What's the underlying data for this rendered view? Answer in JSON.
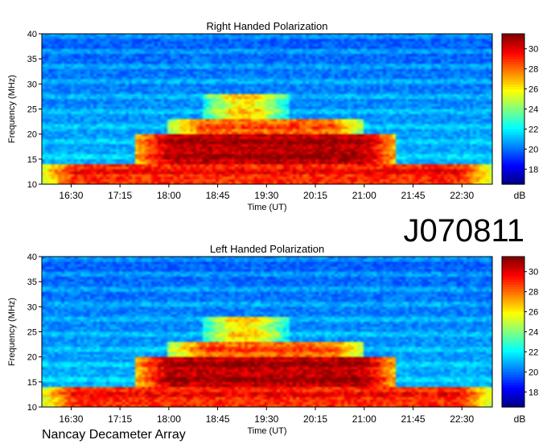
{
  "observation_id": "J070811",
  "footer": "Nancay Decameter Array",
  "colorbar": {
    "ticks": [
      18,
      20,
      22,
      24,
      26,
      28,
      30
    ],
    "range": [
      16.5,
      31.5
    ],
    "unit_label": "dB"
  },
  "colors": {
    "low": "#00008f",
    "mid_low": "#0060ff",
    "mid": "#00e5e5",
    "mid_high": "#ffe000",
    "high": "#ff3000",
    "max": "#8f0000"
  },
  "chart_data": [
    {
      "type": "heatmap",
      "title": "Right Handed Polarization",
      "xlabel": "Time (UT)",
      "ylabel": "Frequency (MHz)",
      "x_ticks": [
        "16:30",
        "17:15",
        "18:00",
        "18:45",
        "19:30",
        "20:15",
        "21:00",
        "21:45",
        "22:30"
      ],
      "x_tick_minutes": [
        990,
        1035,
        1080,
        1125,
        1170,
        1215,
        1260,
        1305,
        1350
      ],
      "x_range_minutes": [
        963,
        1378
      ],
      "y_ticks": [
        10,
        15,
        20,
        25,
        30,
        35,
        40
      ],
      "ylim": [
        10,
        40
      ],
      "zlim": [
        16.5,
        31.5
      ],
      "z_unit": "dB",
      "bursts": [
        {
          "f_low": 10,
          "f_high": 14,
          "t_start": 963,
          "t_end": 1378,
          "level": 29
        },
        {
          "f_low": 14,
          "f_high": 20,
          "t_start": 1050,
          "t_end": 1290,
          "level": 30.5
        },
        {
          "f_low": 20,
          "f_high": 23,
          "t_start": 1080,
          "t_end": 1260,
          "level": 28
        },
        {
          "f_low": 23,
          "f_high": 28,
          "t_start": 1110,
          "t_end": 1190,
          "level": 26
        }
      ]
    },
    {
      "type": "heatmap",
      "title": "Left Handed Polarization",
      "xlabel": "Time (UT)",
      "ylabel": "Frequency (MHz)",
      "x_ticks": [
        "16:30",
        "17:15",
        "18:00",
        "18:45",
        "19:30",
        "20:15",
        "21:00",
        "21:45",
        "22:30"
      ],
      "x_tick_minutes": [
        990,
        1035,
        1080,
        1125,
        1170,
        1215,
        1260,
        1305,
        1350
      ],
      "x_range_minutes": [
        963,
        1378
      ],
      "y_ticks": [
        10,
        15,
        20,
        25,
        30,
        35,
        40
      ],
      "ylim": [
        10,
        40
      ],
      "zlim": [
        16.5,
        31.5
      ],
      "z_unit": "dB",
      "bursts": [
        {
          "f_low": 10,
          "f_high": 14,
          "t_start": 963,
          "t_end": 1378,
          "level": 29
        },
        {
          "f_low": 14,
          "f_high": 20,
          "t_start": 1050,
          "t_end": 1290,
          "level": 30.5
        },
        {
          "f_low": 20,
          "f_high": 23,
          "t_start": 1080,
          "t_end": 1260,
          "level": 28
        },
        {
          "f_low": 23,
          "f_high": 28,
          "t_start": 1110,
          "t_end": 1190,
          "level": 26
        }
      ]
    }
  ]
}
